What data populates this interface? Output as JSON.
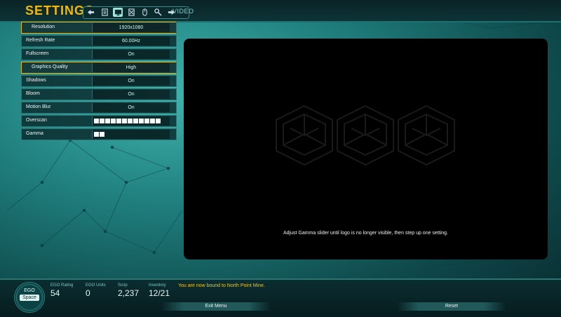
{
  "header": {
    "title": "SETTINGS",
    "section": "VIDEO",
    "tabs": [
      {
        "icon": "back-arrow-icon"
      },
      {
        "icon": "document-icon"
      },
      {
        "icon": "monitor-icon"
      },
      {
        "icon": "network-icon"
      },
      {
        "icon": "mouse-icon"
      },
      {
        "icon": "wrench-icon"
      },
      {
        "icon": "forward-arrow-icon"
      }
    ],
    "active_tab": "monitor-icon"
  },
  "settings": {
    "resolution": {
      "label": "Resolution",
      "value": "1920x1080"
    },
    "refresh_rate": {
      "label": "Refresh Rate",
      "value": "60.00Hz"
    },
    "fullscreen": {
      "label": "Fullscreen",
      "value": "On"
    },
    "graphics_quality": {
      "label": "Graphics Quality",
      "value": "High"
    },
    "shadows": {
      "label": "Shadows",
      "value": "On"
    },
    "bloom": {
      "label": "Bloom",
      "value": "On"
    },
    "motion_blur": {
      "label": "Motion Blur",
      "value": "On"
    },
    "overscan": {
      "label": "Overscan",
      "level": 1.0
    },
    "gamma": {
      "label": "Gamma",
      "level": 0.15
    }
  },
  "preview": {
    "hint": "Adjust Gamma slider until logo is no longer visible, then step up one setting."
  },
  "footer": {
    "ego_label": "EGO",
    "ego_space": "Space",
    "stats": [
      {
        "label": "EGO Rating",
        "value": "54",
        "suffix": ""
      },
      {
        "label": "EGO Units",
        "value": "0",
        "suffix": ""
      },
      {
        "label": "Scrip",
        "value": "2,237",
        "suffix": ""
      },
      {
        "label": "Inventory",
        "value": "12/21",
        "suffix": ""
      }
    ],
    "message": "You are now bound to North Point Mine.",
    "exit_label": "Exit Menu",
    "reset_label": "Reset"
  },
  "colors": {
    "accent": "#f5b800",
    "frame": "#2c7070",
    "panel": "#0a282c"
  }
}
